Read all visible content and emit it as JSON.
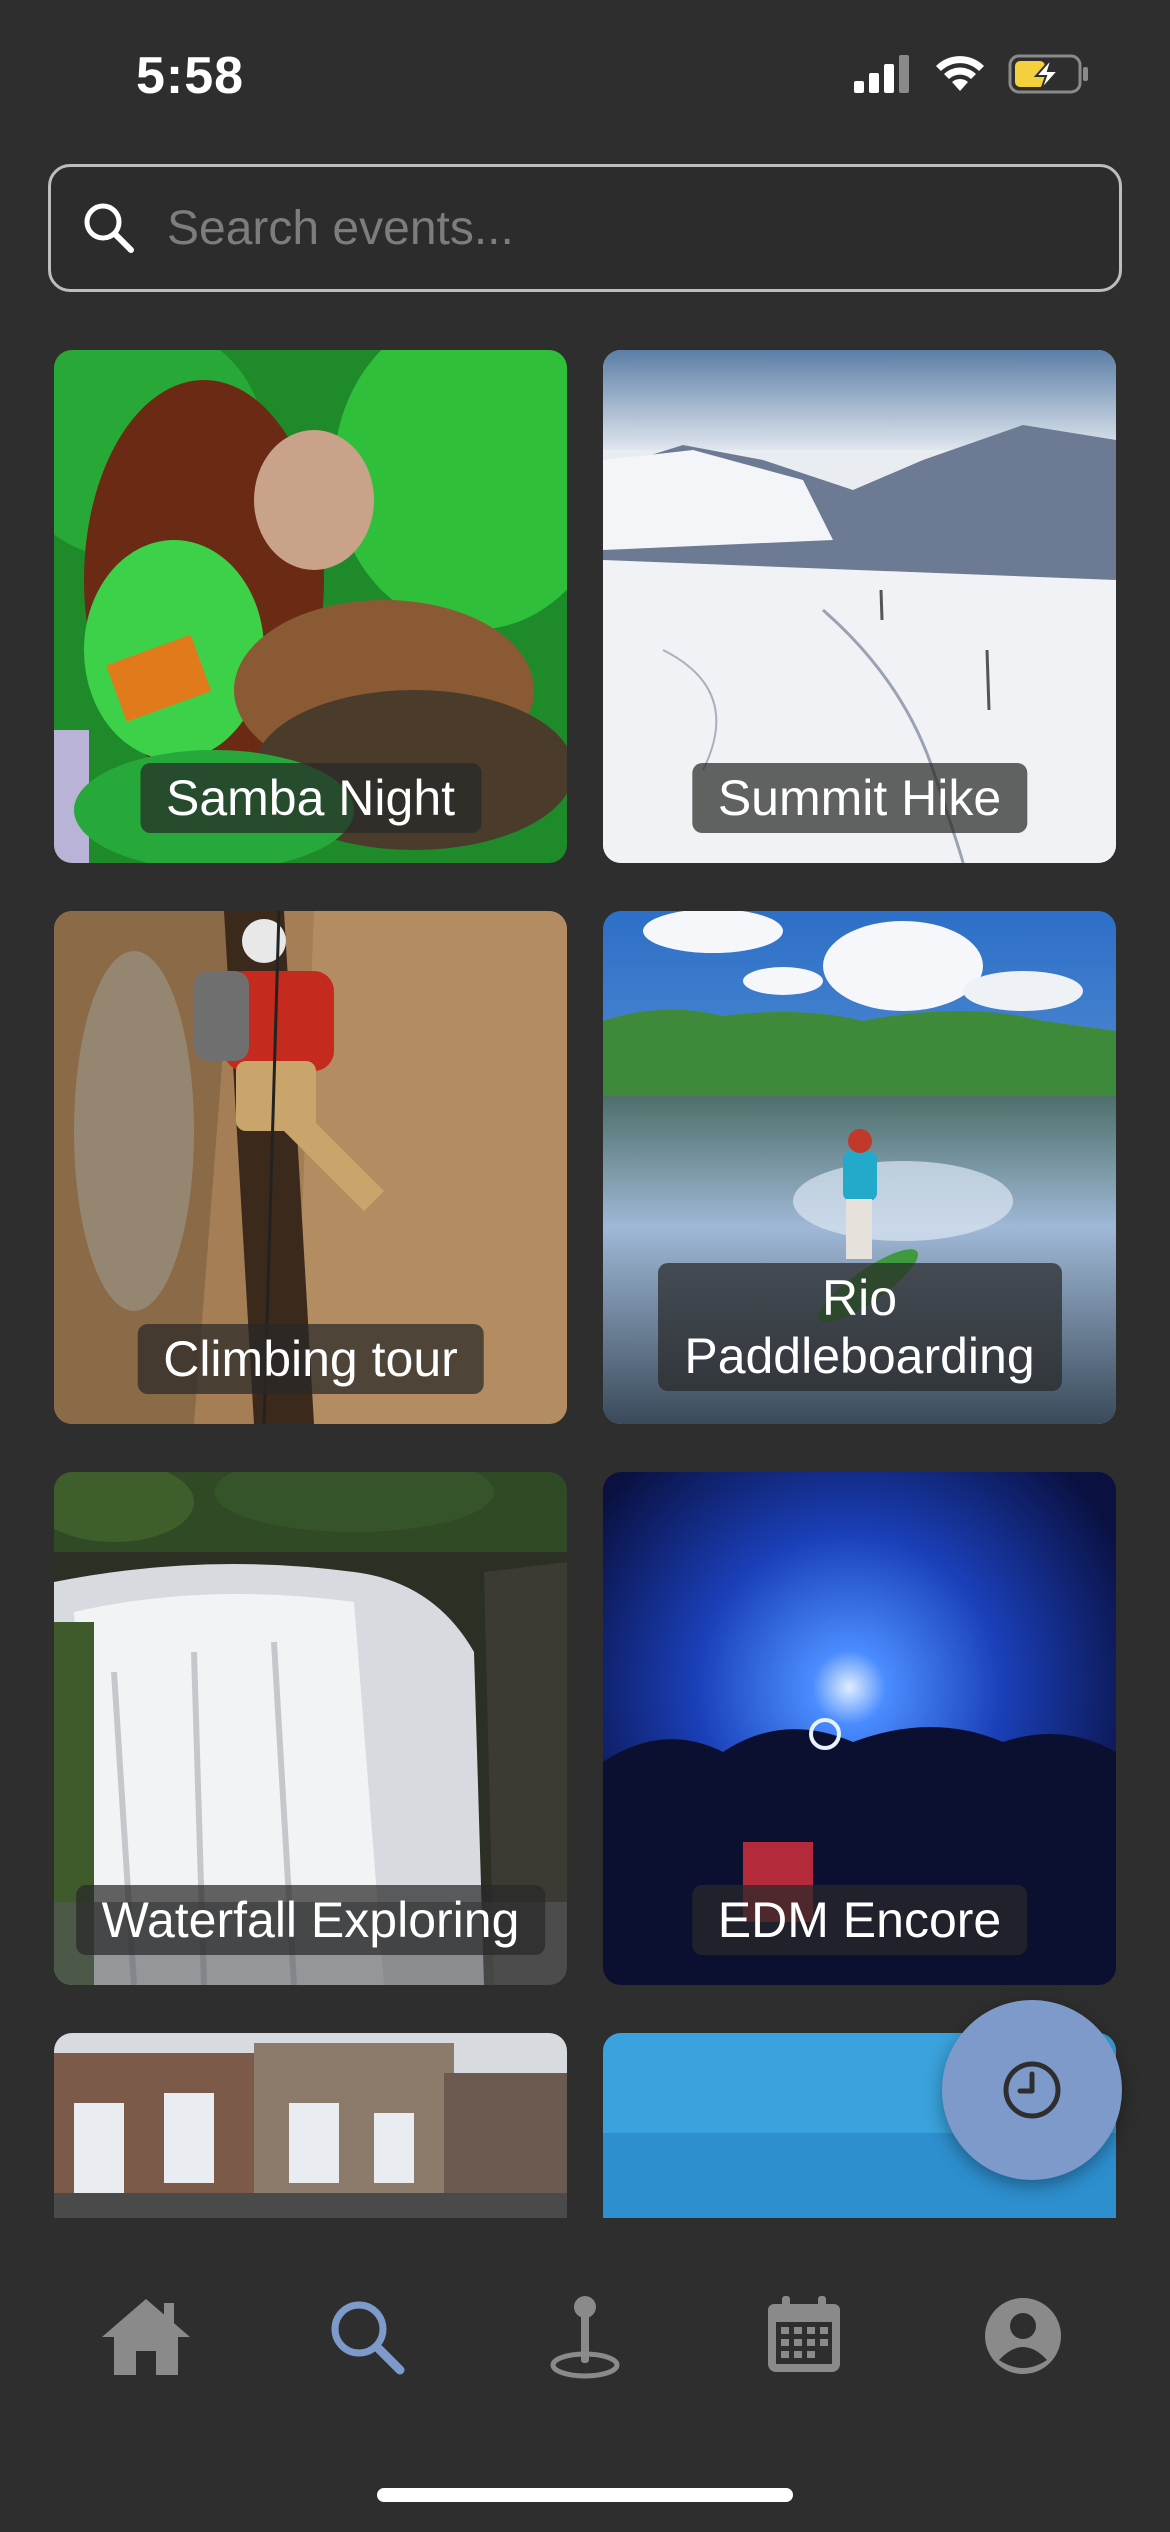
{
  "status_bar": {
    "time": "5:58"
  },
  "search": {
    "placeholder": "Search events..."
  },
  "events": [
    {
      "title": "Samba Night"
    },
    {
      "title": "Summit Hike"
    },
    {
      "title": "Climbing tour"
    },
    {
      "title": "Rio Paddleboarding"
    },
    {
      "title": "Waterfall Exploring"
    },
    {
      "title": "EDM Encore"
    }
  ],
  "nav": {
    "items": [
      "home-icon",
      "search-icon",
      "map-pin-icon",
      "calendar-icon",
      "profile-icon"
    ],
    "active": "search-icon"
  },
  "colors": {
    "background": "#2e2e2e",
    "accent": "#7e9acb",
    "nav_inactive": "#8a8a8a",
    "battery": "#f4d03f"
  }
}
